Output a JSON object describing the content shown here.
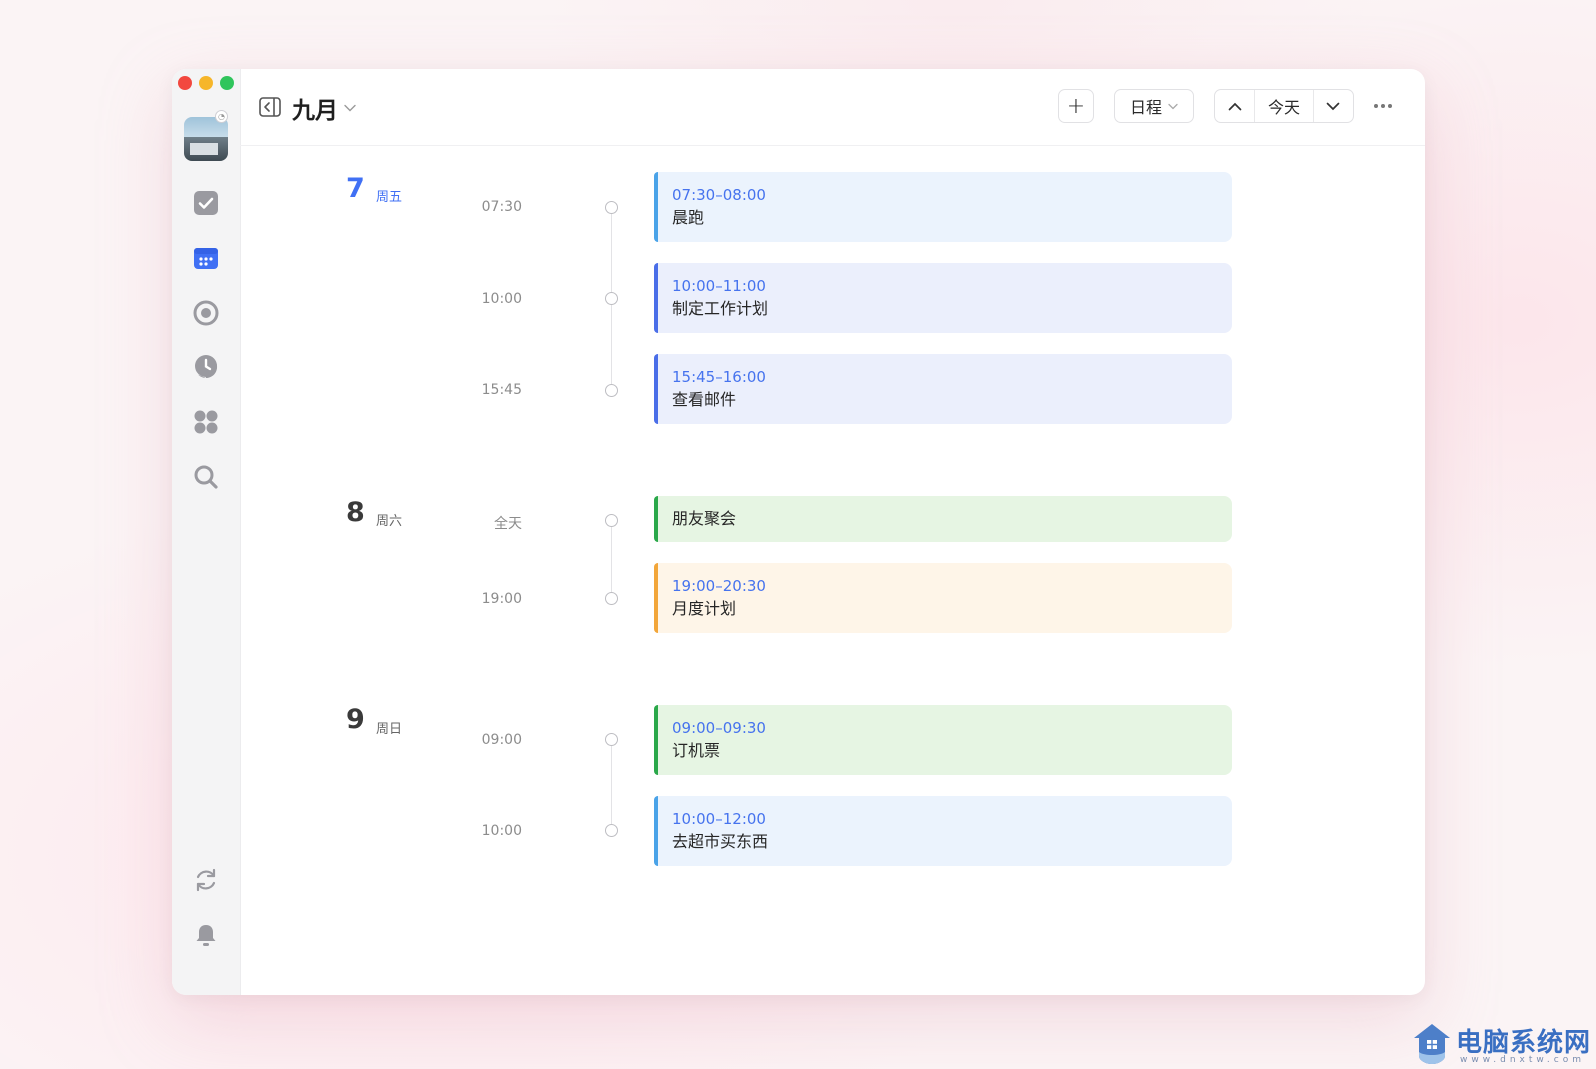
{
  "header": {
    "month_title": "九月",
    "add_label": "+",
    "view_label": "日程",
    "today_label": "今天"
  },
  "sidebar": {
    "items": [
      {
        "icon": "checkbox-icon",
        "active": false
      },
      {
        "icon": "calendar-icon",
        "active": true
      },
      {
        "icon": "focus-target-icon",
        "active": false
      },
      {
        "icon": "clock-icon",
        "active": false
      },
      {
        "icon": "apps-grid-icon",
        "active": false
      },
      {
        "icon": "search-icon",
        "active": false
      }
    ],
    "bottom": [
      {
        "icon": "sync-icon"
      },
      {
        "icon": "bell-icon"
      }
    ]
  },
  "days": [
    {
      "num": "7",
      "weekday": "周五",
      "is_today": true,
      "events": [
        {
          "label": "07:30",
          "time": "07:30–08:00",
          "title": "晨跑",
          "color": "#4aa3e8",
          "bg": "#ebf3fd"
        },
        {
          "label": "10:00",
          "time": "10:00–11:00",
          "title": "制定工作计划",
          "color": "#4a6ee8",
          "bg": "#ebeffc"
        },
        {
          "label": "15:45",
          "time": "15:45–16:00",
          "title": "查看邮件",
          "color": "#4a6ee8",
          "bg": "#ebeffc"
        }
      ]
    },
    {
      "num": "8",
      "weekday": "周六",
      "is_today": false,
      "events": [
        {
          "label": "全天",
          "time": "",
          "title": "朋友聚会",
          "color": "#2aa84a",
          "bg": "#e6f5e3"
        },
        {
          "label": "19:00",
          "time": "19:00–20:30",
          "title": "月度计划",
          "color": "#f2a63a",
          "bg": "#fef5e8"
        }
      ]
    },
    {
      "num": "9",
      "weekday": "周日",
      "is_today": false,
      "events": [
        {
          "label": "09:00",
          "time": "09:00–09:30",
          "title": "订机票",
          "color": "#2aa84a",
          "bg": "#e6f5e3"
        },
        {
          "label": "10:00",
          "time": "10:00–12:00",
          "title": "去超市买东西",
          "color": "#4aa3e8",
          "bg": "#ebf3fd"
        }
      ]
    }
  ],
  "watermark": {
    "text": "电脑系统网",
    "sub": "www.dnxtw.com"
  }
}
